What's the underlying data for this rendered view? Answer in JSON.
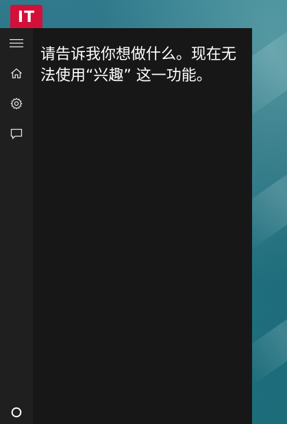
{
  "branding": {
    "logo_text": "IT",
    "logo_color": "#d2103a"
  },
  "sidebar": {
    "items": [
      {
        "icon": "hamburger-menu-icon",
        "label": "Menu"
      },
      {
        "icon": "home-icon",
        "label": "Home"
      },
      {
        "icon": "gear-icon",
        "label": "Settings"
      },
      {
        "icon": "feedback-icon",
        "label": "Feedback"
      }
    ],
    "bottom_item": {
      "icon": "cortana-circle-icon",
      "label": "Cortana"
    }
  },
  "main": {
    "message": "请告诉我你想做什么。现在无法使用“兴趣” 这一功能。"
  },
  "colors": {
    "rail_background": "#1f1f1f",
    "panel_background": "#171717",
    "text": "#ffffff",
    "wallpaper": "#1f6777"
  }
}
